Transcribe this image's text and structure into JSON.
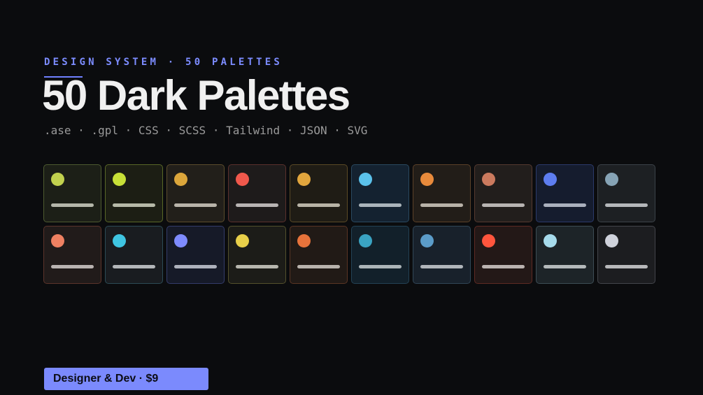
{
  "header": {
    "eyebrow": "DESIGN SYSTEM · 50 PALETTES",
    "title": "50 Dark Palettes",
    "formats": ".ase · .gpl · CSS · SCSS · Tailwind · JSON · SVG"
  },
  "palettes": [
    {
      "accent": "#c1d14e",
      "bg": "#1c1f17",
      "border": "#4e5a30",
      "bar": "#b4b6aa"
    },
    {
      "accent": "#c7e037",
      "bg": "#1c1e14",
      "border": "#596827",
      "bar": "#b6b9a8"
    },
    {
      "accent": "#dca63b",
      "bg": "#221f1a",
      "border": "#5c4d2c",
      "bar": "#b9b4aa"
    },
    {
      "accent": "#f0584c",
      "bg": "#1e1b1b",
      "border": "#5b302c",
      "bar": "#b8b4b3"
    },
    {
      "accent": "#e2a63d",
      "bg": "#1f1c15",
      "border": "#5b4a26",
      "bar": "#b8b3a6"
    },
    {
      "accent": "#5bc2eb",
      "bg": "#142230",
      "border": "#2a4960",
      "bar": "#aab4ba"
    },
    {
      "accent": "#e88a3b",
      "bg": "#221d18",
      "border": "#5c4128",
      "bar": "#b8b2a8"
    },
    {
      "accent": "#cb7a5e",
      "bg": "#221e1c",
      "border": "#55392f",
      "bar": "#b8b4b2"
    },
    {
      "accent": "#5d7df0",
      "bg": "#151c2e",
      "border": "#2b3a6a",
      "bar": "#aab0bd"
    },
    {
      "accent": "#86a3b5",
      "bg": "#1d2023",
      "border": "#3b4248",
      "bar": "#b4b7ba"
    },
    {
      "accent": "#ef8162",
      "bg": "#211b1a",
      "border": "#5b342b",
      "bar": "#b9b3b1"
    },
    {
      "accent": "#3fc5e2",
      "bg": "#191c20",
      "border": "#2c4b55",
      "bar": "#b3b6b9"
    },
    {
      "accent": "#7e8bff",
      "bg": "#161a28",
      "border": "#343c6b",
      "bar": "#adb1bc"
    },
    {
      "accent": "#e8cf49",
      "bg": "#1c1c18",
      "border": "#53502c",
      "bar": "#b7b6ae"
    },
    {
      "accent": "#e7733b",
      "bg": "#211a16",
      "border": "#5a3524",
      "bar": "#b8b2ac"
    },
    {
      "accent": "#3aa3c2",
      "bg": "#12202a",
      "border": "#234255",
      "bar": "#abb4b8"
    },
    {
      "accent": "#5b9cc9",
      "bg": "#18212b",
      "border": "#314656",
      "bar": "#b0b5ba"
    },
    {
      "accent": "#ff553d",
      "bg": "#231817",
      "border": "#5e2a23",
      "bar": "#bab2b0"
    },
    {
      "accent": "#a6dbec",
      "bg": "#1d2428",
      "border": "#3d4d55",
      "bar": "#b4b9bb"
    },
    {
      "accent": "#cfd2db",
      "bg": "#1c1d20",
      "border": "#43454b",
      "bar": "#b7b8ba"
    }
  ],
  "cta": {
    "label": "Designer & Dev · $9"
  }
}
